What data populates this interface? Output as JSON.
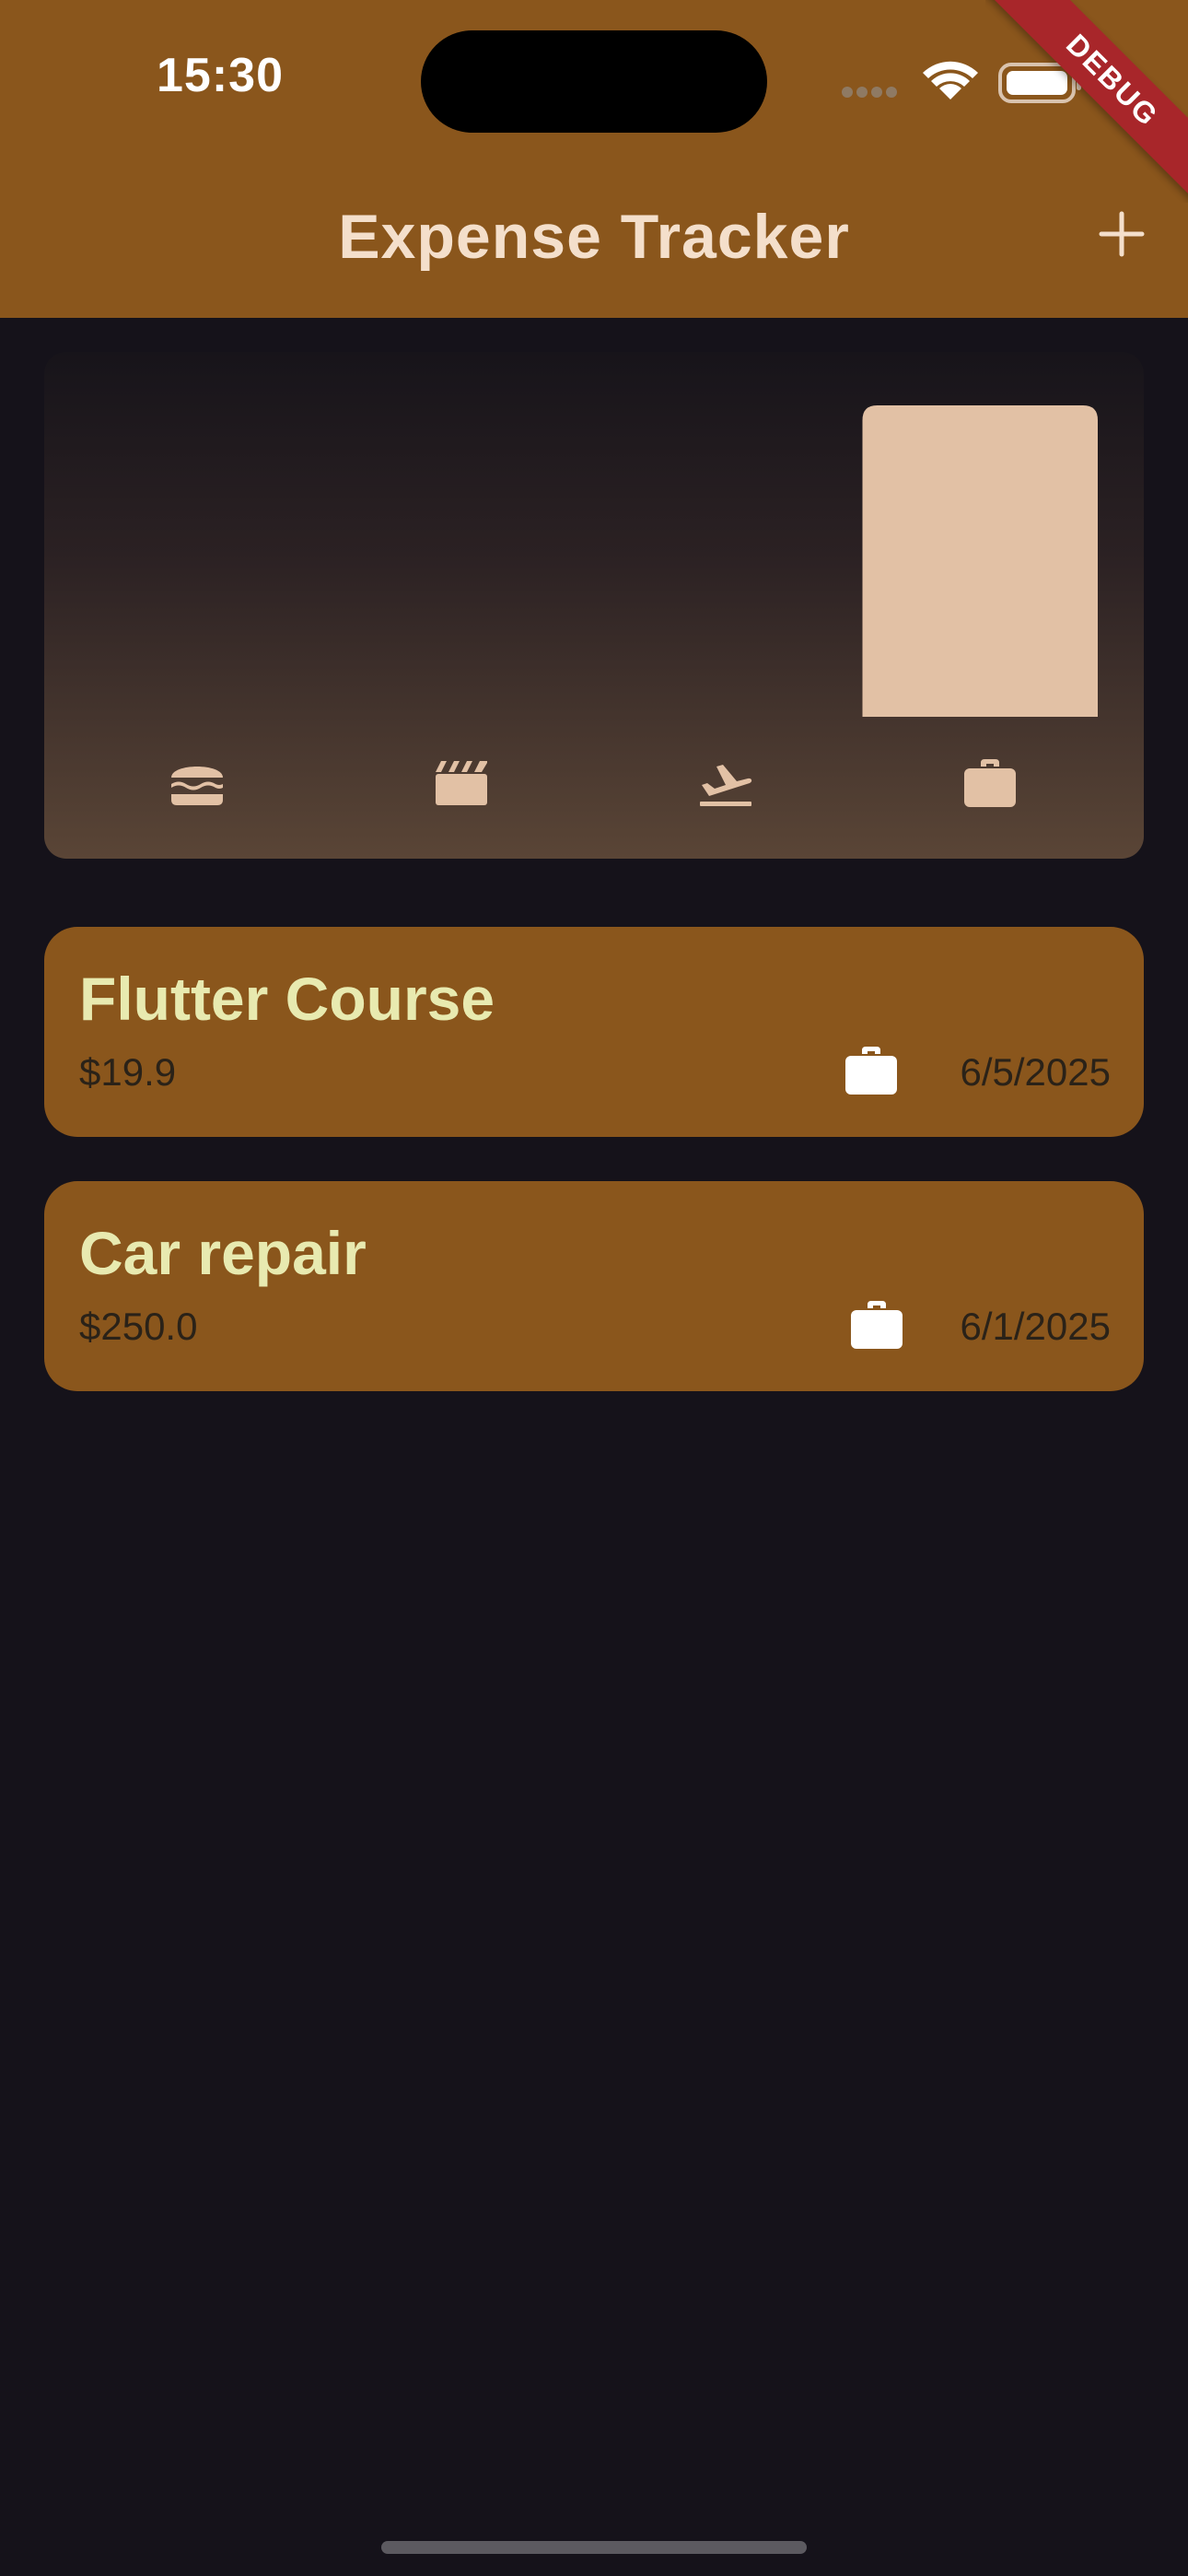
{
  "status_bar": {
    "time": "15:30",
    "icons": [
      "cellular-signal-icon",
      "wifi-icon",
      "battery-icon"
    ]
  },
  "debug_banner": "DEBUG",
  "app_bar": {
    "title": "Expense Tracker",
    "action_icon": "add-icon"
  },
  "chart": {
    "categories": [
      {
        "name": "food",
        "icon": "hamburger-icon",
        "fill": 0
      },
      {
        "name": "leisure",
        "icon": "movie-clapper-icon",
        "fill": 0
      },
      {
        "name": "travel",
        "icon": "flight-takeoff-icon",
        "fill": 0
      },
      {
        "name": "work",
        "icon": "briefcase-icon",
        "fill": 1
      }
    ]
  },
  "expenses": [
    {
      "title": "Flutter Course",
      "amount": "$19.9",
      "icon": "briefcase-icon",
      "date": "6/5/2025"
    },
    {
      "title": "Car repair",
      "amount": "$250.0",
      "icon": "briefcase-icon",
      "date": "6/1/2025"
    }
  ],
  "colors": {
    "app_bar": "#8a561c",
    "background": "#15121a",
    "bar": "#e2c1a5",
    "title_text": "#f4dfcb",
    "expense_title": "#e8eab0",
    "debug_ribbon": "#a8262a"
  }
}
